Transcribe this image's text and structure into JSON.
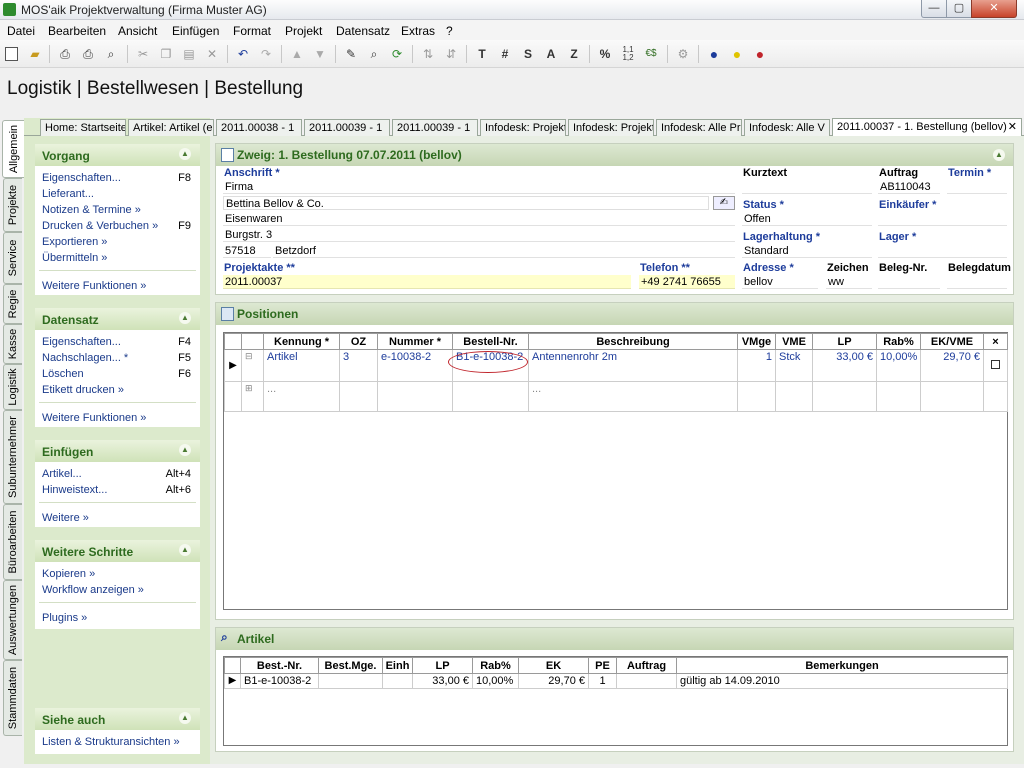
{
  "window": {
    "title": "MOS'aik Projektverwaltung (Firma Muster AG)",
    "min": "—",
    "max": "▢",
    "close": "✕"
  },
  "menu": [
    "Datei",
    "Bearbeiten",
    "Ansicht",
    "Einfügen",
    "Format",
    "Projekt",
    "Datensatz",
    "Extras",
    "?"
  ],
  "toolbar": {
    "text_buttons": [
      "T",
      "#",
      "S",
      "A",
      "Z",
      "%",
      "€$"
    ]
  },
  "page_title": "Logistik | Bestellwesen | Bestellung",
  "vtabs": [
    "Allgemein",
    "Projekte",
    "Service",
    "Regie",
    "Kasse",
    "Logistik",
    "Subunternehmer",
    "Büroarbeiten",
    "Auswertungen",
    "Stammdaten"
  ],
  "doc_tabs": [
    "Home: Startseite",
    "Artikel: Artikel (e",
    "2011.00038 - 1",
    "2011.00039 - 1",
    "2011.00039 - 1",
    "Infodesk: Projekt",
    "Infodesk: Projekt",
    "Infodesk: Alle Pr",
    "Infodesk: Alle V",
    "2011.00037 - 1. Bestellung (bellov)"
  ],
  "doc_tab_close": "✕",
  "sidebar": {
    "vorgang": {
      "title": "Vorgang",
      "items": [
        [
          "Eigenschaften...",
          "F8"
        ],
        [
          "Lieferant...",
          ""
        ],
        [
          "Notizen & Termine »",
          ""
        ],
        [
          "Drucken & Verbuchen »",
          "F9"
        ],
        [
          "Exportieren »",
          ""
        ],
        [
          "Übermitteln »",
          ""
        ]
      ],
      "more": "Weitere Funktionen »"
    },
    "datensatz": {
      "title": "Datensatz",
      "items": [
        [
          "Eigenschaften...",
          "F4"
        ],
        [
          "Nachschlagen... *",
          "F5"
        ],
        [
          "Löschen",
          "F6"
        ],
        [
          "Etikett drucken »",
          ""
        ]
      ],
      "more": "Weitere Funktionen »"
    },
    "einfuegen": {
      "title": "Einfügen",
      "items": [
        [
          "Artikel...",
          "Alt+4"
        ],
        [
          "Hinweistext...",
          "Alt+6"
        ]
      ],
      "more": "Weitere »"
    },
    "schritte": {
      "title": "Weitere Schritte",
      "items": [
        "Kopieren »",
        "Workflow anzeigen »"
      ],
      "more": "Plugins »"
    },
    "siehe": {
      "title": "Siehe auch",
      "items": [
        "Listen & Strukturansichten »"
      ]
    }
  },
  "header_section": {
    "title": "Zweig: 1. Bestellung 07.07.2011 (bellov)",
    "anschrift_label": "Anschrift *",
    "anschrift": [
      "Firma",
      "Bettina Bellov & Co.",
      "Eisenwaren",
      "Burgstr. 3"
    ],
    "plz": "57518",
    "ort": "Betzdorf",
    "projektakte_label": "Projektakte **",
    "projektakte": "2011.00037",
    "telefon_label": "Telefon **",
    "telefon": "+49 2741 76655",
    "kurztext_label": "Kurztext",
    "kurztext": "",
    "auftrag_label": "Auftrag",
    "auftrag": "AB110043",
    "termin_label": "Termin *",
    "termin": "",
    "status_label": "Status *",
    "status": "Offen",
    "einkaeufer_label": "Einkäufer *",
    "einkaeufer": "",
    "lagerhaltung_label": "Lagerhaltung *",
    "lagerhaltung": "Standard",
    "lager_label": "Lager *",
    "lager": "",
    "adresse_label": "Adresse *",
    "adresse": "bellov",
    "zeichen_label": "Zeichen",
    "zeichen": "ww",
    "belegnr_label": "Beleg-Nr.",
    "belegnr": "",
    "belegdatum_label": "Belegdatum",
    "belegdatum": ""
  },
  "positionen": {
    "title": "Positionen",
    "columns": [
      "Kennung *",
      "OZ",
      "Nummer *",
      "Bestell-Nr.",
      "Beschreibung",
      "VMge",
      "VME",
      "LP",
      "Rab%",
      "EK/VME",
      "×"
    ],
    "rows": [
      [
        "Artikel",
        "3",
        "e-10038-2",
        "B1-e-10038-2",
        "Antennenrohr 2m",
        "1",
        "Stck",
        "33,00 €",
        "10,00%",
        "29,70 €"
      ]
    ],
    "new_row": [
      "...",
      "..."
    ]
  },
  "artikel": {
    "title": "Artikel",
    "columns": [
      "Best.-Nr.",
      "Best.Mge.",
      "Einh",
      "LP",
      "Rab%",
      "EK",
      "PE",
      "Auftrag",
      "Bemerkungen"
    ],
    "rows": [
      [
        "B1-e-10038-2",
        "",
        "",
        "33,00 €",
        "10,00%",
        "29,70 €",
        "1",
        "",
        "gültig ab 14.09.2010"
      ]
    ]
  },
  "colors": {
    "accent_green": "#2e6b1f",
    "label_blue": "#1d3c9b",
    "highlight_circle": "#c0242b",
    "sidebar_bg": "#dceacc"
  }
}
